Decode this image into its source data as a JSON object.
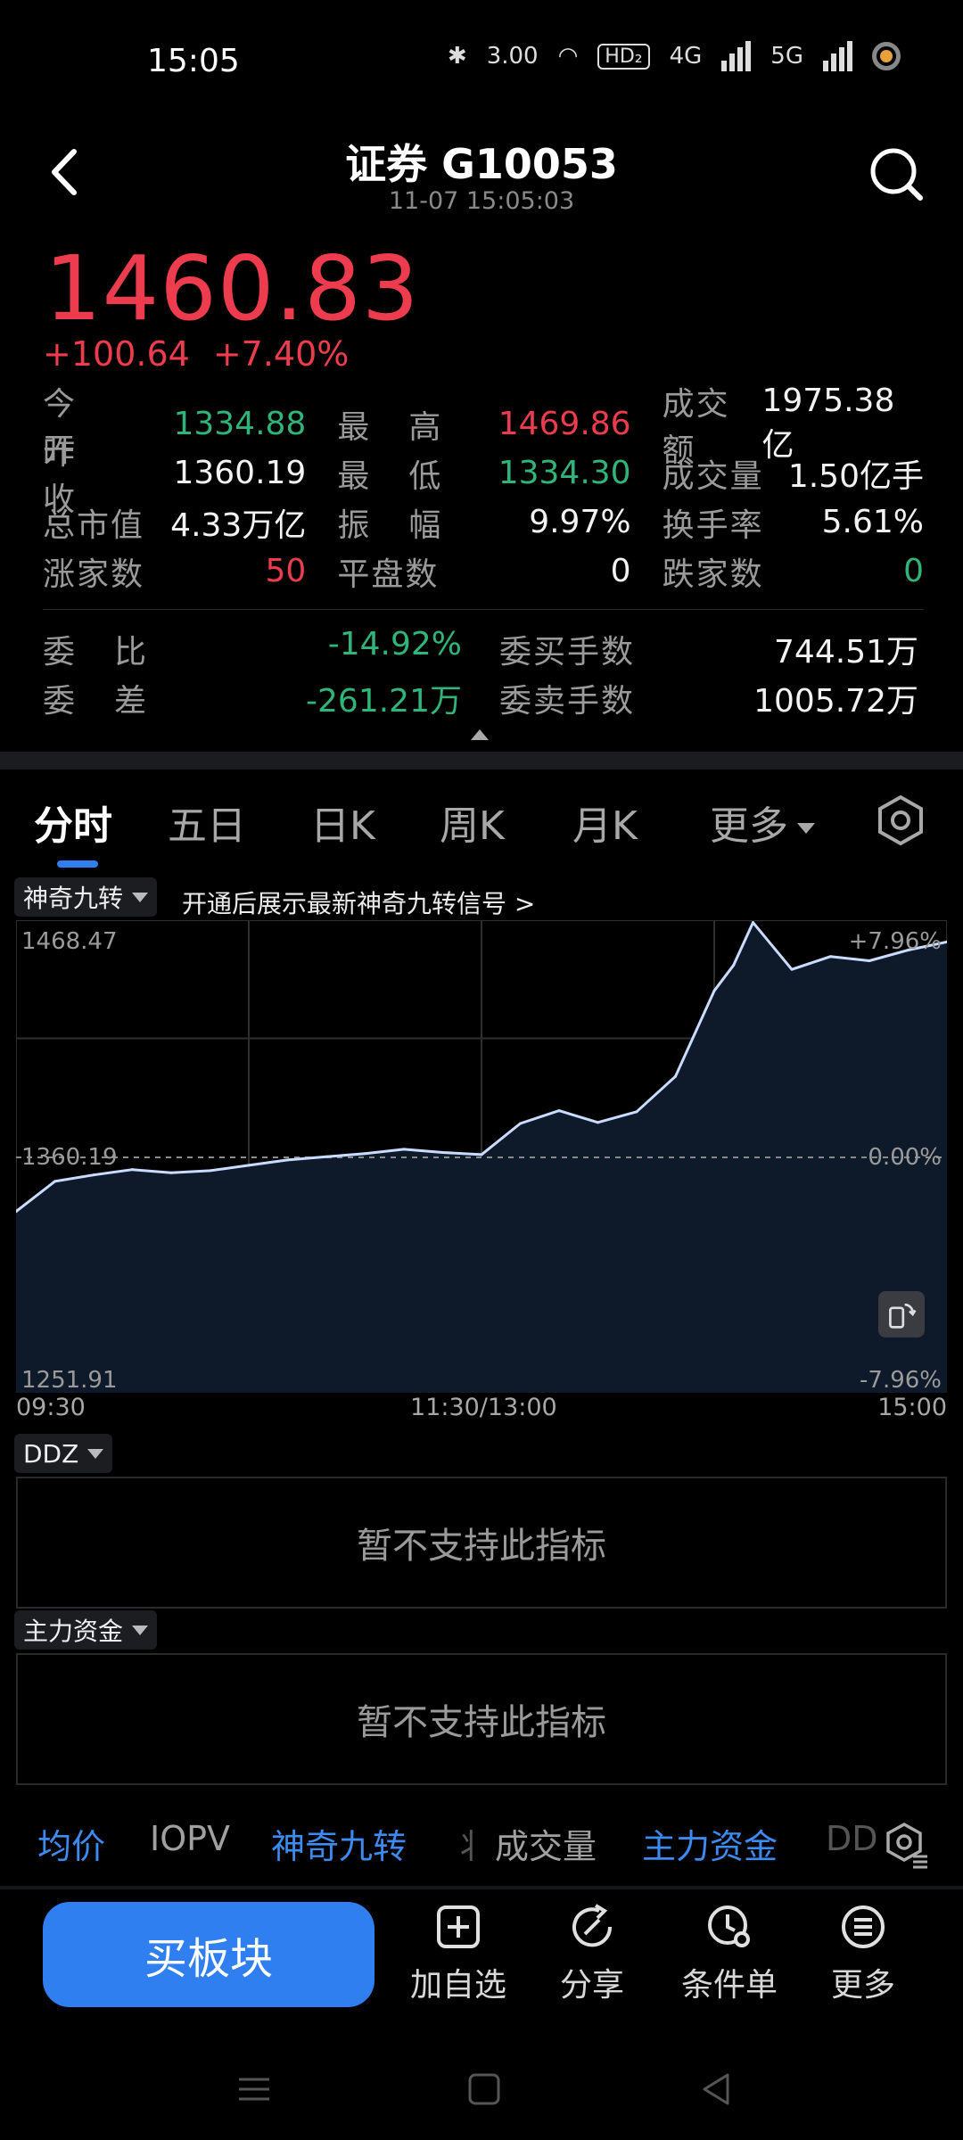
{
  "status_bar": {
    "time": "15:05",
    "net_speed": "3.00",
    "hd": "HD₂",
    "sig1": "4G",
    "sig2": "5G"
  },
  "header": {
    "title": "证券 G10053",
    "timestamp": "11-07 15:05:03"
  },
  "quote": {
    "price": "1460.83",
    "change": "+100.64",
    "change_pct": "+7.40%"
  },
  "stats": [
    [
      {
        "label": "今开",
        "value": "1334.88",
        "color": "green"
      },
      {
        "label": "最高",
        "value": "1469.86",
        "color": "red"
      },
      {
        "label": "成交额",
        "value": "1975.38亿",
        "color": "white"
      }
    ],
    [
      {
        "label": "昨收",
        "value": "1360.19",
        "color": "white"
      },
      {
        "label": "最低",
        "value": "1334.30",
        "color": "green"
      },
      {
        "label": "成交量",
        "value": "1.50亿手",
        "color": "white"
      }
    ],
    [
      {
        "label": "总市值",
        "value": "4.33万亿",
        "color": "white"
      },
      {
        "label": "振幅",
        "value": "9.97%",
        "color": "white"
      },
      {
        "label": "换手率",
        "value": "5.61%",
        "color": "white"
      }
    ],
    [
      {
        "label": "涨家数",
        "value": "50",
        "color": "red"
      },
      {
        "label": "平盘数",
        "value": "0",
        "color": "white"
      },
      {
        "label": "跌家数",
        "value": "0",
        "color": "green"
      }
    ]
  ],
  "order_stats": [
    [
      {
        "label": "委比",
        "value": "-14.92%",
        "color": "green"
      },
      {
        "label": "委买手数",
        "value": "744.51万",
        "color": "white"
      }
    ],
    [
      {
        "label": "委差",
        "value": "-261.21万",
        "color": "green"
      },
      {
        "label": "委卖手数",
        "value": "1005.72万",
        "color": "white"
      }
    ]
  ],
  "tabs": [
    "分时",
    "五日",
    "日K",
    "周K",
    "月K",
    "更多"
  ],
  "chart_toolbar": {
    "nine_turn_label": "神奇九转",
    "nine_turn_hint": "开通后展示最新神奇九转信号 >"
  },
  "chart_data": {
    "type": "line",
    "title": "",
    "xlabel": "",
    "ylabel": "",
    "x_ticks": [
      "09:30",
      "11:30/13:00",
      "15:00"
    ],
    "ylim": [
      1251.91,
      1468.47
    ],
    "y_labels": {
      "top": "1468.47",
      "mid": "1360.19",
      "bottom": "1251.91"
    },
    "pct_labels": {
      "top": "+7.96%",
      "mid": "0.00%",
      "bottom": "-7.96%"
    },
    "reference": 1360.19,
    "grid": true,
    "series": [
      {
        "x": [
          "09:30",
          "09:40",
          "09:50",
          "10:00",
          "10:10",
          "10:20",
          "10:30",
          "10:40",
          "10:50",
          "11:00",
          "11:10",
          "11:20",
          "11:30",
          "13:10",
          "13:20",
          "13:30",
          "13:40",
          "13:50",
          "14:00",
          "14:05",
          "14:10",
          "14:20",
          "14:30",
          "14:40",
          "14:50",
          "15:00"
        ],
        "values": [
          1334.9,
          1349.0,
          1352.0,
          1354.5,
          1353.0,
          1354.0,
          1356.5,
          1359.0,
          1360.5,
          1362.0,
          1364.0,
          1362.5,
          1361.5,
          1376.0,
          1382.0,
          1376.5,
          1381.5,
          1398.0,
          1438.0,
          1450.0,
          1469.9,
          1448.0,
          1454.0,
          1452.0,
          1457.0,
          1460.8
        ]
      }
    ]
  },
  "panels": [
    {
      "label": "DDZ",
      "message": "暂不支持此指标"
    },
    {
      "label": "主力资金",
      "message": "暂不支持此指标"
    }
  ],
  "indicators": [
    {
      "label": "均价",
      "style": "blue"
    },
    {
      "label": "IOPV",
      "style": "gray"
    },
    {
      "label": "神奇九转",
      "style": "blue"
    },
    {
      "label": "成交量",
      "style": "gray"
    },
    {
      "label": "主力资金",
      "style": "blue"
    },
    {
      "label": "DD",
      "style": "dim"
    }
  ],
  "bottom_bar": {
    "buy_label": "买板块",
    "actions": [
      "加自选",
      "分享",
      "条件单",
      "更多"
    ]
  },
  "colors": {
    "up": "#ee3c4f",
    "down": "#2fb57a",
    "accent": "#2f7ff0",
    "line": "#c9dcff",
    "area": "#0e1a2a"
  }
}
